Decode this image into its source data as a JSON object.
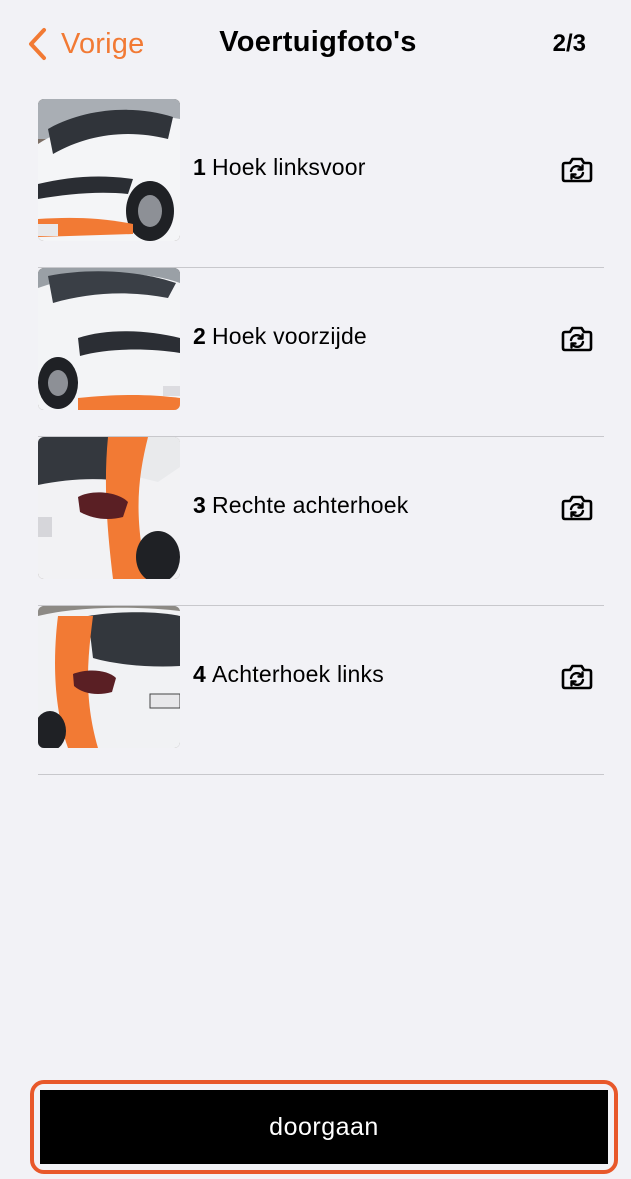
{
  "header": {
    "back_label": "Vorige",
    "title": "Voertuigfoto's",
    "step": "2/3"
  },
  "photos": [
    {
      "number": "1",
      "label": "Hoek linksvoor"
    },
    {
      "number": "2",
      "label": "Hoek voorzijde"
    },
    {
      "number": "3",
      "label": "Rechte achterhoek"
    },
    {
      "number": "4",
      "label": "Achterhoek links"
    }
  ],
  "continue_label": "doorgaan",
  "icons": {
    "back": "chevron-left-icon",
    "retake": "camera-retake-icon"
  },
  "colors": {
    "accent": "#f27a34",
    "highlight_border": "#e8582a",
    "button": "#000000",
    "background": "#f2f2f6"
  }
}
